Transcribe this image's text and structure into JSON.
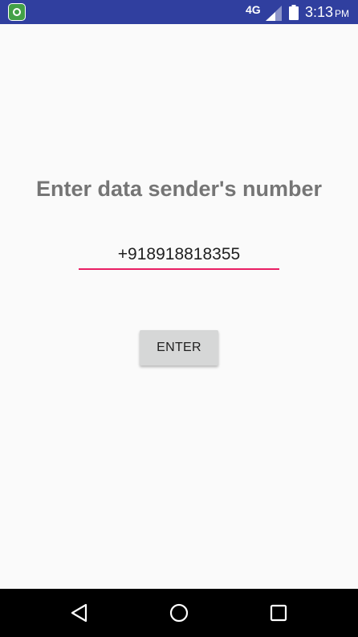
{
  "status_bar": {
    "app_icon": "app-notification-icon",
    "network": "4G",
    "signal_icon": "cellular-signal-icon",
    "battery_icon": "battery-icon",
    "time": "3:13",
    "ampm": "PM"
  },
  "main": {
    "title": "Enter data sender's number",
    "phone_value": "+918918818355",
    "enter_label": "ENTER"
  },
  "nav_bar": {
    "back_icon": "back-triangle-icon",
    "home_icon": "home-circle-icon",
    "recents_icon": "recents-square-icon"
  },
  "colors": {
    "status_bar": "#303f9f",
    "input_underline": "#e91e63",
    "title": "#757575",
    "button": "#d6d7d7",
    "nav_bar": "#000000"
  }
}
